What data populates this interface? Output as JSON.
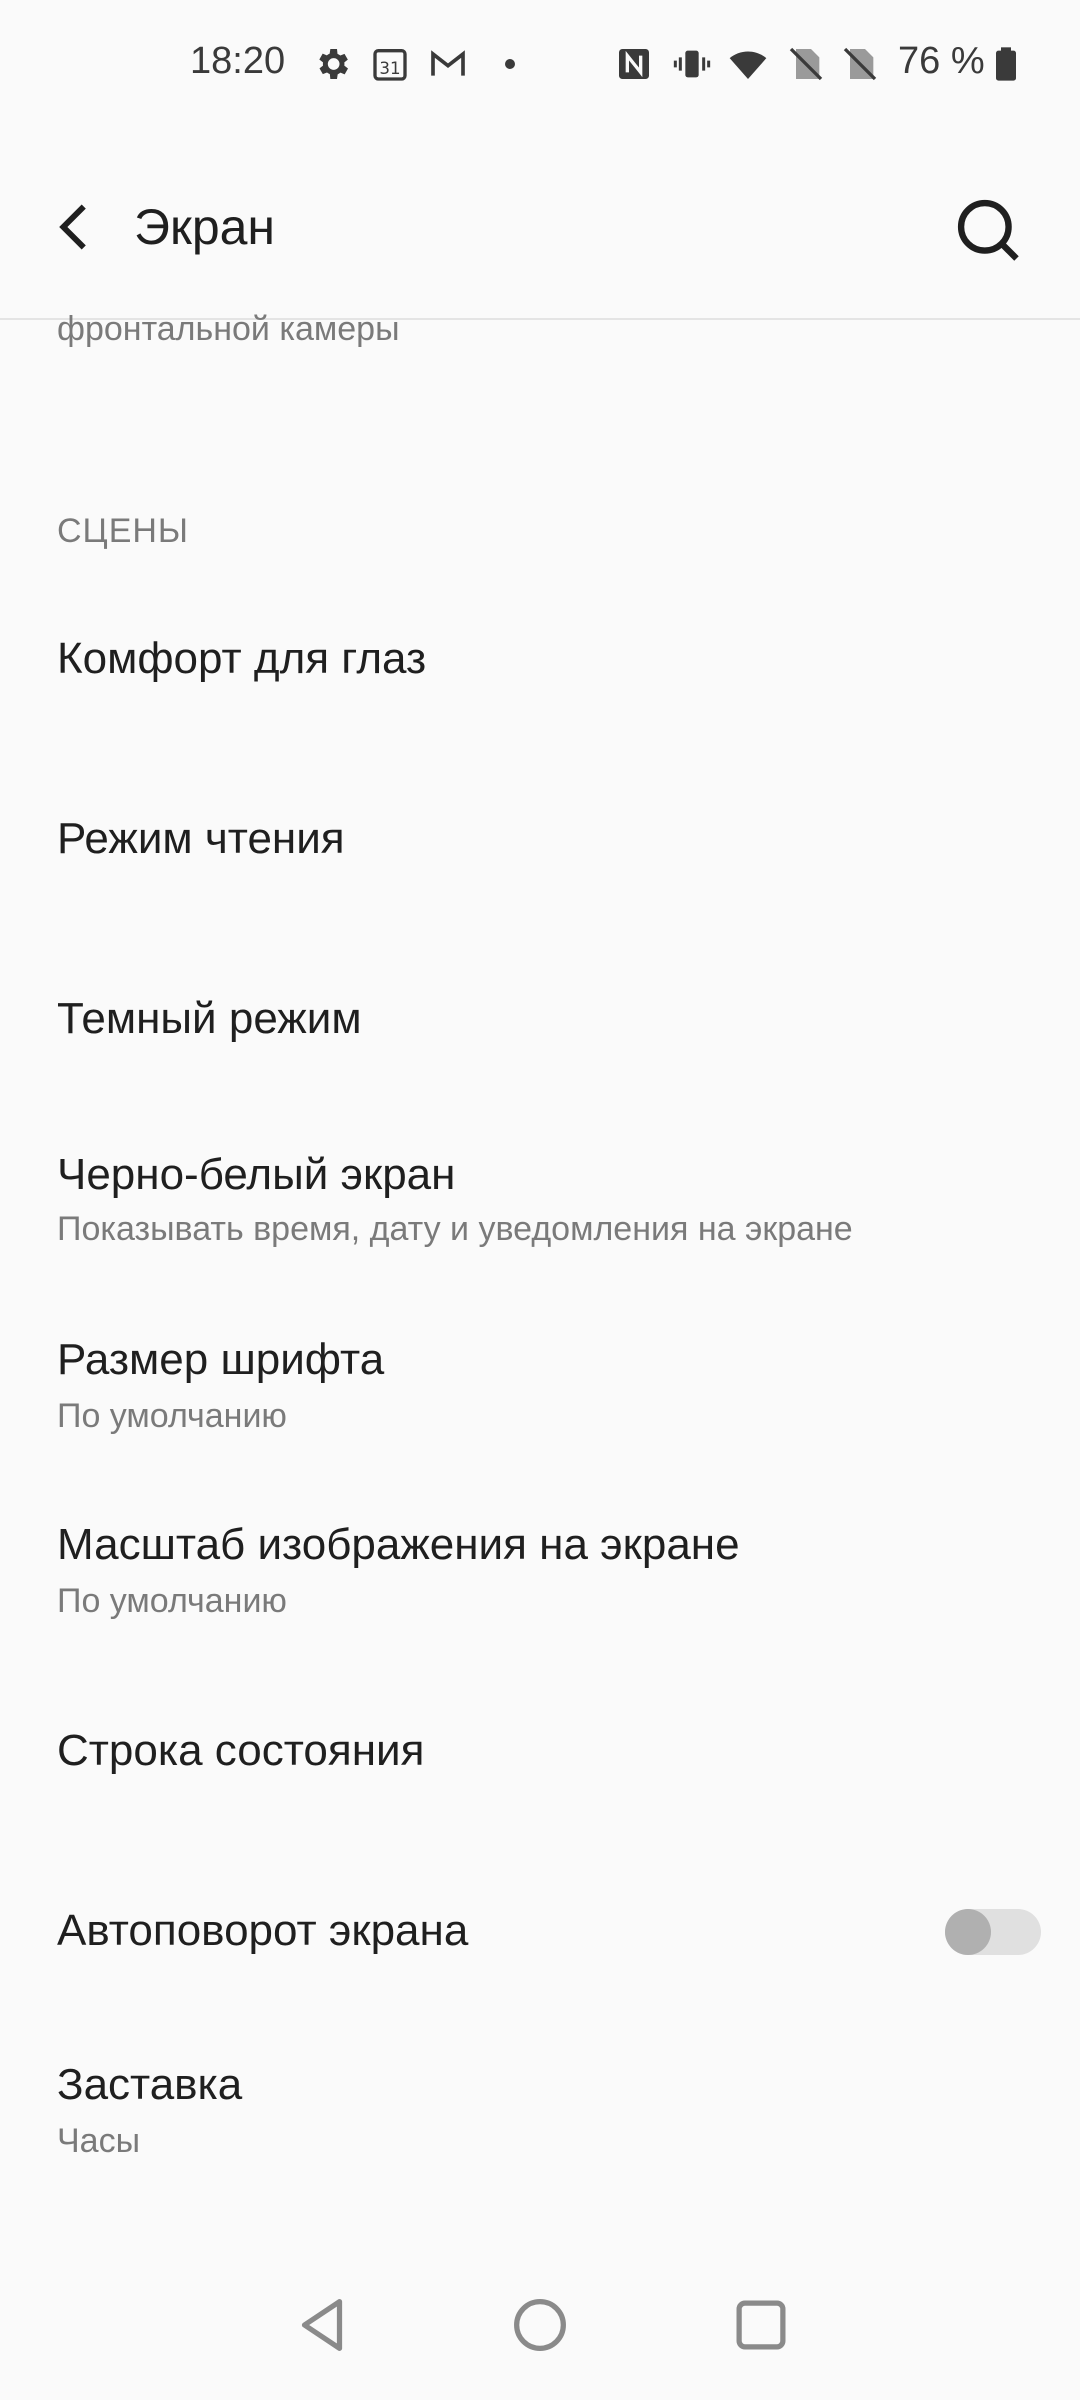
{
  "status_bar": {
    "time": "18:20",
    "battery_text": "76 %",
    "icons": [
      "gear-icon",
      "calendar-icon",
      "gmail-icon",
      "dot-icon",
      "nfc-icon",
      "vibrate-icon",
      "wifi-icon",
      "no-sim-icon",
      "no-sim-icon",
      "battery-icon"
    ],
    "calendar_day": "31"
  },
  "app_bar": {
    "title": "Экран",
    "back_icon": "back-arrow-icon",
    "search_icon": "search-icon"
  },
  "list": {
    "clipped_subtitle": "фронтальной камеры",
    "section_header": "СЦЕНЫ",
    "items": [
      {
        "title": "Комфорт для глаз"
      },
      {
        "title": "Режим чтения"
      },
      {
        "title": "Темный режим"
      },
      {
        "title": "Черно-белый экран",
        "subtitle": "Показывать время, дату и уведомления на экране"
      },
      {
        "title": "Размер шрифта",
        "subtitle": "По умолчанию"
      },
      {
        "title": "Масштаб изображения на экране",
        "subtitle": "По умолчанию"
      },
      {
        "title": "Строка состояния"
      },
      {
        "title": "Автоповорот экрана",
        "toggle_on": false
      },
      {
        "title": "Заставка",
        "subtitle": "Часы"
      }
    ]
  },
  "nav_bar": {
    "icons": [
      "nav-back-icon",
      "nav-home-icon",
      "nav-recents-icon"
    ]
  },
  "colors": {
    "background": "#fafafa",
    "text_primary": "#1f1f1f",
    "text_secondary": "#7a7a7a",
    "toggle_track": "#e0e0e0",
    "toggle_knob": "#b0b0b0"
  }
}
